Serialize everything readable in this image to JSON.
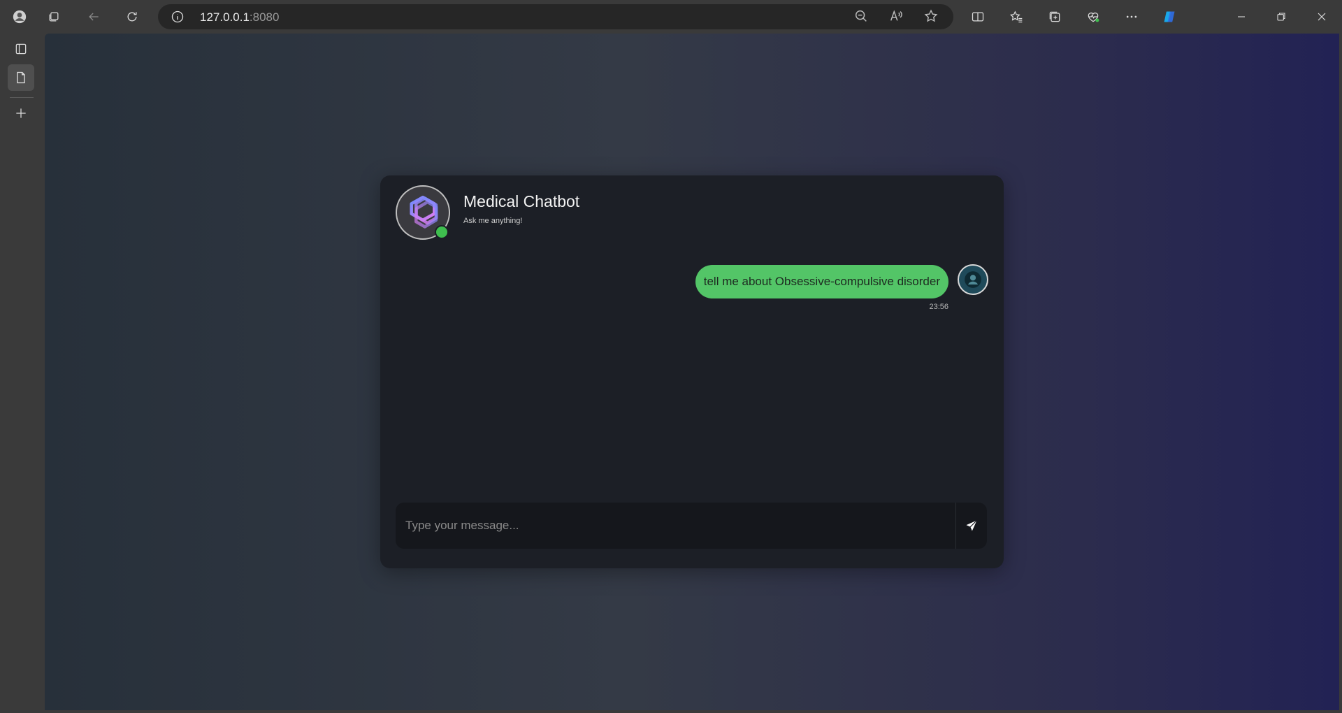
{
  "browser": {
    "url_host": "127.0.0.1",
    "url_port": ":8080"
  },
  "chat": {
    "title": "Medical Chatbot",
    "subtitle": "Ask me anything!",
    "status_color": "#3fbf4f",
    "messages": [
      {
        "sender": "user",
        "text": "tell me about Obsessive-compulsive disorder",
        "time": "23:56",
        "bubble_color": "#53c567"
      }
    ],
    "input": {
      "placeholder": "Type your message...",
      "value": ""
    }
  },
  "colors": {
    "accent_user_bubble": "#53c567",
    "card_background": "#1c1f26",
    "online_indicator": "#3fbf4f"
  }
}
